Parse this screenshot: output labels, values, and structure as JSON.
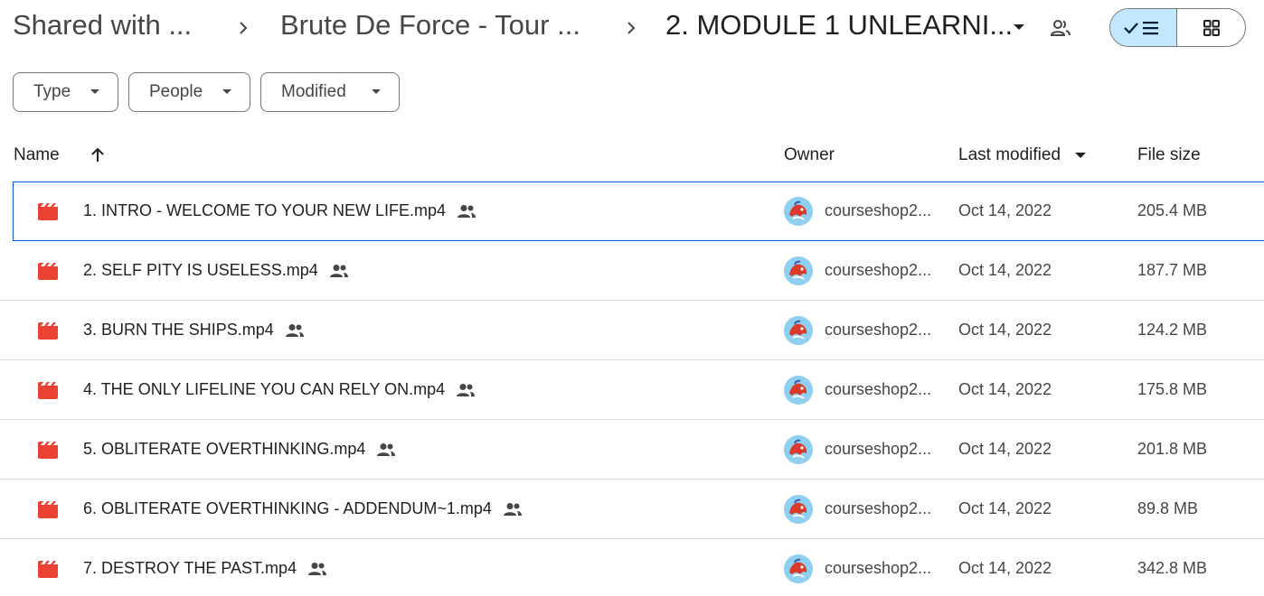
{
  "breadcrumb": {
    "root": "Shared with ...",
    "parent": "Brute De Force - Tour ...",
    "current": "2. MODULE 1 UNLEARNI..."
  },
  "view_toggle": {
    "active": "list"
  },
  "filters": [
    {
      "label": "Type"
    },
    {
      "label": "People"
    },
    {
      "label": "Modified"
    }
  ],
  "columns": {
    "name": "Name",
    "owner": "Owner",
    "last_modified": "Last modified",
    "file_size": "File size"
  },
  "colors": {
    "accent": "#0b57d0",
    "toggle_active": "#c2e7ff",
    "video_icon": "#ea4335"
  },
  "files": [
    {
      "name": "1. INTRO - WELCOME TO YOUR NEW LIFE.mp4",
      "owner": "courseshop2...",
      "modified": "Oct 14, 2022",
      "size": "205.4 MB",
      "selected": true
    },
    {
      "name": "2. SELF PITY IS USELESS.mp4",
      "owner": "courseshop2...",
      "modified": "Oct 14, 2022",
      "size": "187.7 MB"
    },
    {
      "name": "3. BURN THE SHIPS.mp4",
      "owner": "courseshop2...",
      "modified": "Oct 14, 2022",
      "size": "124.2 MB"
    },
    {
      "name": "4. THE ONLY LIFELINE YOU CAN RELY ON.mp4",
      "owner": "courseshop2...",
      "modified": "Oct 14, 2022",
      "size": "175.8 MB"
    },
    {
      "name": "5. OBLITERATE OVERTHINKING.mp4",
      "owner": "courseshop2...",
      "modified": "Oct 14, 2022",
      "size": "201.8 MB"
    },
    {
      "name": "6. OBLITERATE OVERTHINKING - ADDENDUM~1.mp4",
      "owner": "courseshop2...",
      "modified": "Oct 14, 2022",
      "size": "89.8 MB"
    },
    {
      "name": "7. DESTROY THE PAST.mp4",
      "owner": "courseshop2...",
      "modified": "Oct 14, 2022",
      "size": "342.8 MB"
    }
  ]
}
